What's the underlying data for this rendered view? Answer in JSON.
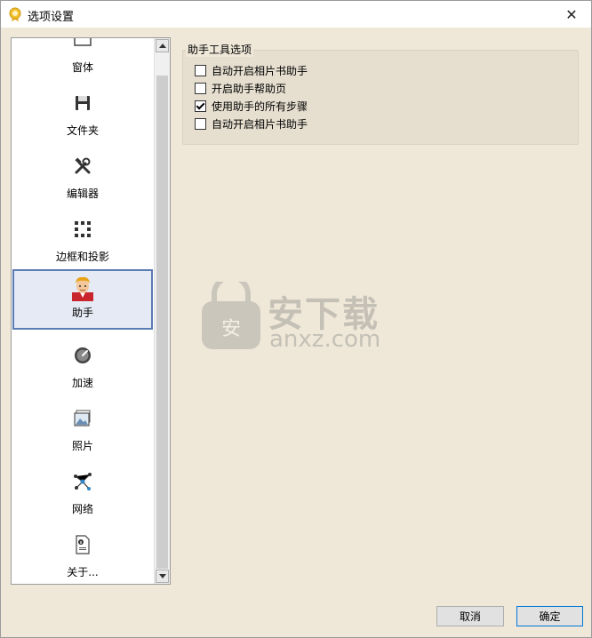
{
  "window": {
    "title": "选项设置",
    "close_glyph": "✕"
  },
  "sidebar": {
    "items": [
      {
        "label": "窗体",
        "icon": "window-icon"
      },
      {
        "label": "文件夹",
        "icon": "floppy-disk-icon"
      },
      {
        "label": "编辑器",
        "icon": "tools-icon"
      },
      {
        "label": "边框和投影",
        "icon": "border-dots-icon"
      },
      {
        "label": "助手",
        "icon": "assistant-avatar-icon",
        "selected": true
      },
      {
        "label": "加速",
        "icon": "speedometer-icon"
      },
      {
        "label": "照片",
        "icon": "photo-icon"
      },
      {
        "label": "网络",
        "icon": "network-icon"
      },
      {
        "label": "关于...",
        "icon": "about-document-icon"
      }
    ]
  },
  "group": {
    "title": "助手工具选项",
    "options": [
      {
        "label": "自动开启相片书助手",
        "checked": false
      },
      {
        "label": "开启助手帮助页",
        "checked": false
      },
      {
        "label": "使用助手的所有步骤",
        "checked": true
      },
      {
        "label": "自动开启相片书助手",
        "checked": false
      }
    ]
  },
  "watermark": {
    "text_cn": "安下载",
    "text_en": "anxz.com",
    "badge": "安"
  },
  "footer": {
    "cancel_label": "取消",
    "ok_label": "确定"
  },
  "colors": {
    "selected_border": "#5b7bb3",
    "background": "#efe8d9",
    "ok_border": "#0078d7"
  }
}
